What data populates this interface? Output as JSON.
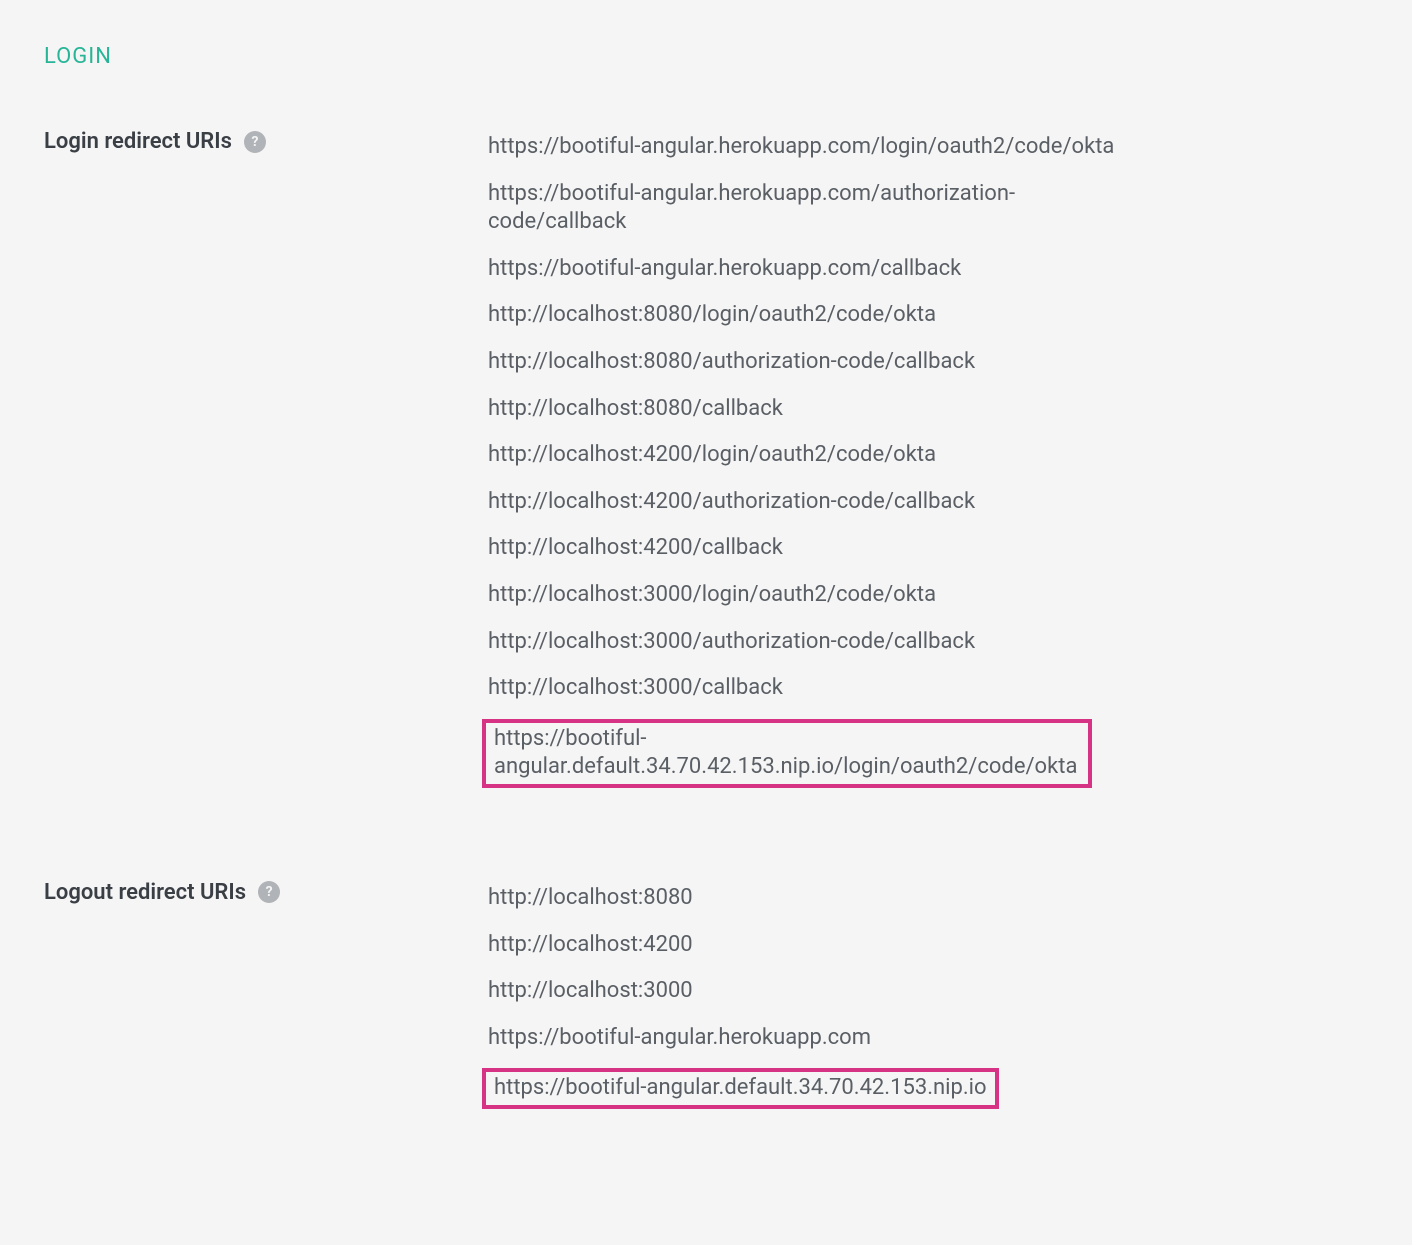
{
  "section": {
    "heading": "LOGIN"
  },
  "login_redirect": {
    "label": "Login redirect URIs",
    "uris": [
      {
        "value": "https://bootiful-angular.herokuapp.com/login/oauth2/code/okta",
        "highlight": false
      },
      {
        "value": "https://bootiful-angular.herokuapp.com/authorization-code/callback",
        "highlight": false
      },
      {
        "value": "https://bootiful-angular.herokuapp.com/callback",
        "highlight": false
      },
      {
        "value": "http://localhost:8080/login/oauth2/code/okta",
        "highlight": false
      },
      {
        "value": "http://localhost:8080/authorization-code/callback",
        "highlight": false
      },
      {
        "value": "http://localhost:8080/callback",
        "highlight": false
      },
      {
        "value": "http://localhost:4200/login/oauth2/code/okta",
        "highlight": false
      },
      {
        "value": "http://localhost:4200/authorization-code/callback",
        "highlight": false
      },
      {
        "value": "http://localhost:4200/callback",
        "highlight": false
      },
      {
        "value": "http://localhost:3000/login/oauth2/code/okta",
        "highlight": false
      },
      {
        "value": "http://localhost:3000/authorization-code/callback",
        "highlight": false
      },
      {
        "value": "http://localhost:3000/callback",
        "highlight": false
      },
      {
        "value": "https://bootiful-angular.default.34.70.42.153.nip.io/login/oauth2/code/okta",
        "highlight": true
      }
    ]
  },
  "logout_redirect": {
    "label": "Logout redirect URIs",
    "uris": [
      {
        "value": "http://localhost:8080",
        "highlight": false
      },
      {
        "value": "http://localhost:4200",
        "highlight": false
      },
      {
        "value": "http://localhost:3000",
        "highlight": false
      },
      {
        "value": "https://bootiful-angular.herokuapp.com",
        "highlight": false
      },
      {
        "value": "https://bootiful-angular.default.34.70.42.153.nip.io",
        "highlight": true
      }
    ]
  },
  "help_glyph": "?"
}
